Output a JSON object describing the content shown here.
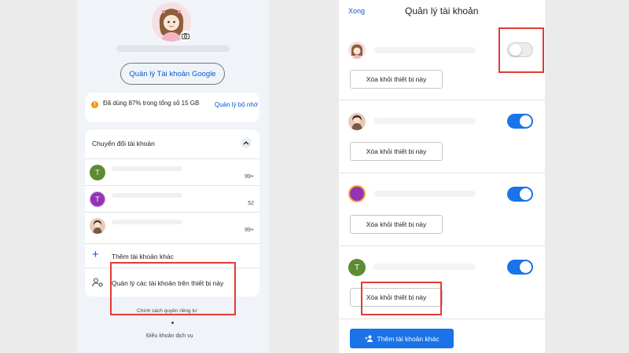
{
  "left_panel": {
    "manage_google_account": "Quản lý Tài khoản Google",
    "storage": {
      "text": "Đã dùng 87% trong tổng số 15 GB",
      "link": "Quản lý bộ nhớ",
      "warn_icon": "!"
    },
    "switch_accounts": "Chuyển đổi tài khoản",
    "accounts": [
      {
        "initial": "T",
        "count": "99+",
        "color": "#5b8c32"
      },
      {
        "initial": "T",
        "count": "52",
        "color": "#9334b5"
      },
      {
        "initial": "",
        "count": "99+",
        "color": "#e9c9b6"
      }
    ],
    "add_account": "Thêm tài khoản khác",
    "add_icon": "+",
    "manage_accounts": "Quản lý các tài khoản trên thiết bị này",
    "privacy": "Chính sách quyền riêng tư",
    "terms": "Điều khoản dịch vụ"
  },
  "right_panel": {
    "done": "Xong",
    "title": "Quản lý tài khoản",
    "remove_label": "Xóa khỏi thiết bị này",
    "avatar_initials": [
      "",
      "",
      "",
      "T"
    ],
    "toggles": [
      false,
      true,
      true,
      true
    ],
    "add_account": "Thêm tài khoản khác"
  },
  "colors": {
    "accent": "#0b57d0",
    "toggle_on": "#1a73e8",
    "highlight": "#e53935"
  }
}
